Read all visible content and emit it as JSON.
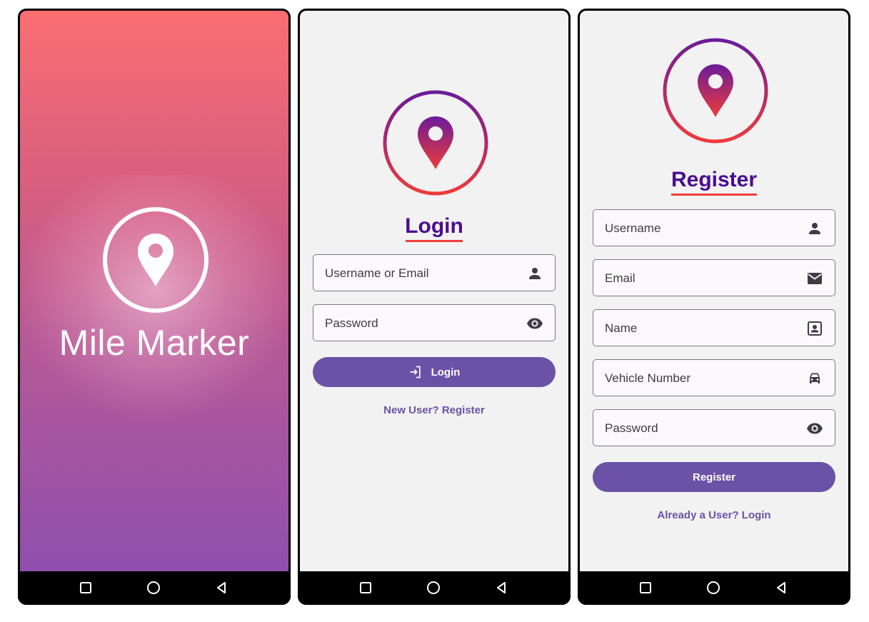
{
  "colors": {
    "accent": "#6b52a6",
    "heading": "#4a0d8f",
    "underline": "#ef3e3e",
    "screen_bg": "#f2f2f2"
  },
  "splash": {
    "title": "Mile Marker",
    "logo_icon": "location-pin-icon"
  },
  "login": {
    "logo_icon": "location-pin-icon",
    "heading": "Login",
    "fields": [
      {
        "placeholder": "Username or Email",
        "icon": "person-icon"
      },
      {
        "placeholder": "Password",
        "icon": "eye-icon"
      }
    ],
    "button_label": "Login",
    "button_icon": "login-icon",
    "link": "New User? Register"
  },
  "register": {
    "logo_icon": "location-pin-icon",
    "heading": "Register",
    "fields": [
      {
        "placeholder": "Username",
        "icon": "person-icon"
      },
      {
        "placeholder": "Email",
        "icon": "mail-icon"
      },
      {
        "placeholder": "Name",
        "icon": "contact-card-icon"
      },
      {
        "placeholder": "Vehicle Number",
        "icon": "car-icon"
      },
      {
        "placeholder": "Password",
        "icon": "eye-icon"
      }
    ],
    "button_label": "Register",
    "link": "Already a User? Login"
  },
  "navbar": {
    "buttons": [
      "recents-square-icon",
      "home-circle-icon",
      "back-triangle-icon"
    ]
  }
}
